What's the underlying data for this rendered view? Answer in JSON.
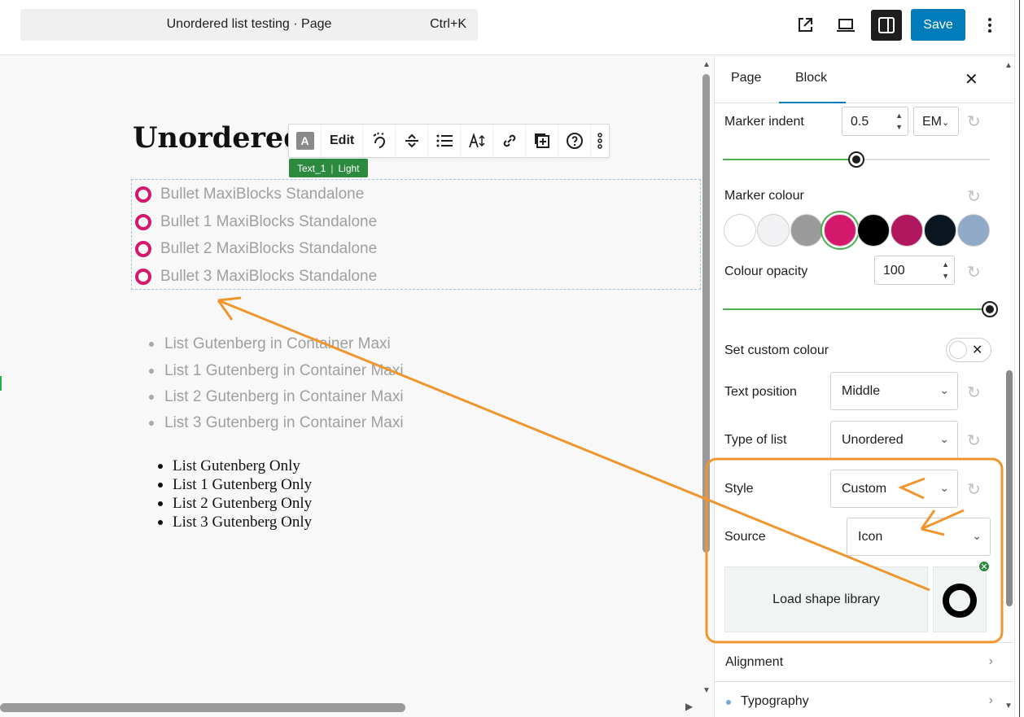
{
  "topbar": {
    "command_title": "Unordered list testing · Page",
    "command_shortcut": "Ctrl+K",
    "save_label": "Save"
  },
  "canvas": {
    "heading": "Unordered",
    "block_toolbar": {
      "edit_label": "Edit",
      "a_label": "A",
      "tag_name": "Text_1",
      "tag_style": "Light"
    },
    "maxi_list": [
      "Bullet MaxiBlocks Standalone",
      "Bullet 1 MaxiBlocks Standalone",
      "Bullet 2 MaxiBlocks Standalone",
      "Bullet 3 MaxiBlocks Standalone"
    ],
    "container_list": [
      "List Gutenberg in Container Maxi",
      "List 1 Gutenberg in Container Maxi",
      "List 2 Gutenberg in Container Maxi",
      "List 3 Gutenberg in Container Maxi"
    ],
    "gutenberg_list": [
      "List Gutenberg Only",
      "List 1 Gutenberg Only",
      "List 2 Gutenberg Only",
      "List 3 Gutenberg Only"
    ]
  },
  "sidebar": {
    "tabs": [
      "Page",
      "Block"
    ],
    "active_tab": "Block",
    "marker_indent": {
      "label": "Marker indent",
      "value": "0.5",
      "unit": "EM",
      "slider_fraction": 0.5
    },
    "marker_colour": {
      "label": "Marker colour",
      "swatches": [
        "#ffffff",
        "#f2f2f4",
        "#9b9b9b",
        "#d4196d",
        "#000000",
        "#b0175e",
        "#0b1520",
        "#8fa9c6"
      ],
      "selected_index": 3
    },
    "colour_opacity": {
      "label": "Colour opacity",
      "value": "100",
      "slider_fraction": 1.0
    },
    "custom_colour": {
      "label": "Set custom colour"
    },
    "text_position": {
      "label": "Text position",
      "value": "Middle"
    },
    "type_of_list": {
      "label": "Type of list",
      "value": "Unordered"
    },
    "style": {
      "label": "Style",
      "value": "Custom"
    },
    "source": {
      "label": "Source",
      "value": "Icon"
    },
    "shape_library_label": "Load shape library",
    "panels": [
      "Alignment",
      "Typography"
    ]
  },
  "colors": {
    "accent": "#007cba",
    "marker": "#d4196d",
    "annotation": "#f0962e",
    "tag_green": "#2b8a3e"
  }
}
